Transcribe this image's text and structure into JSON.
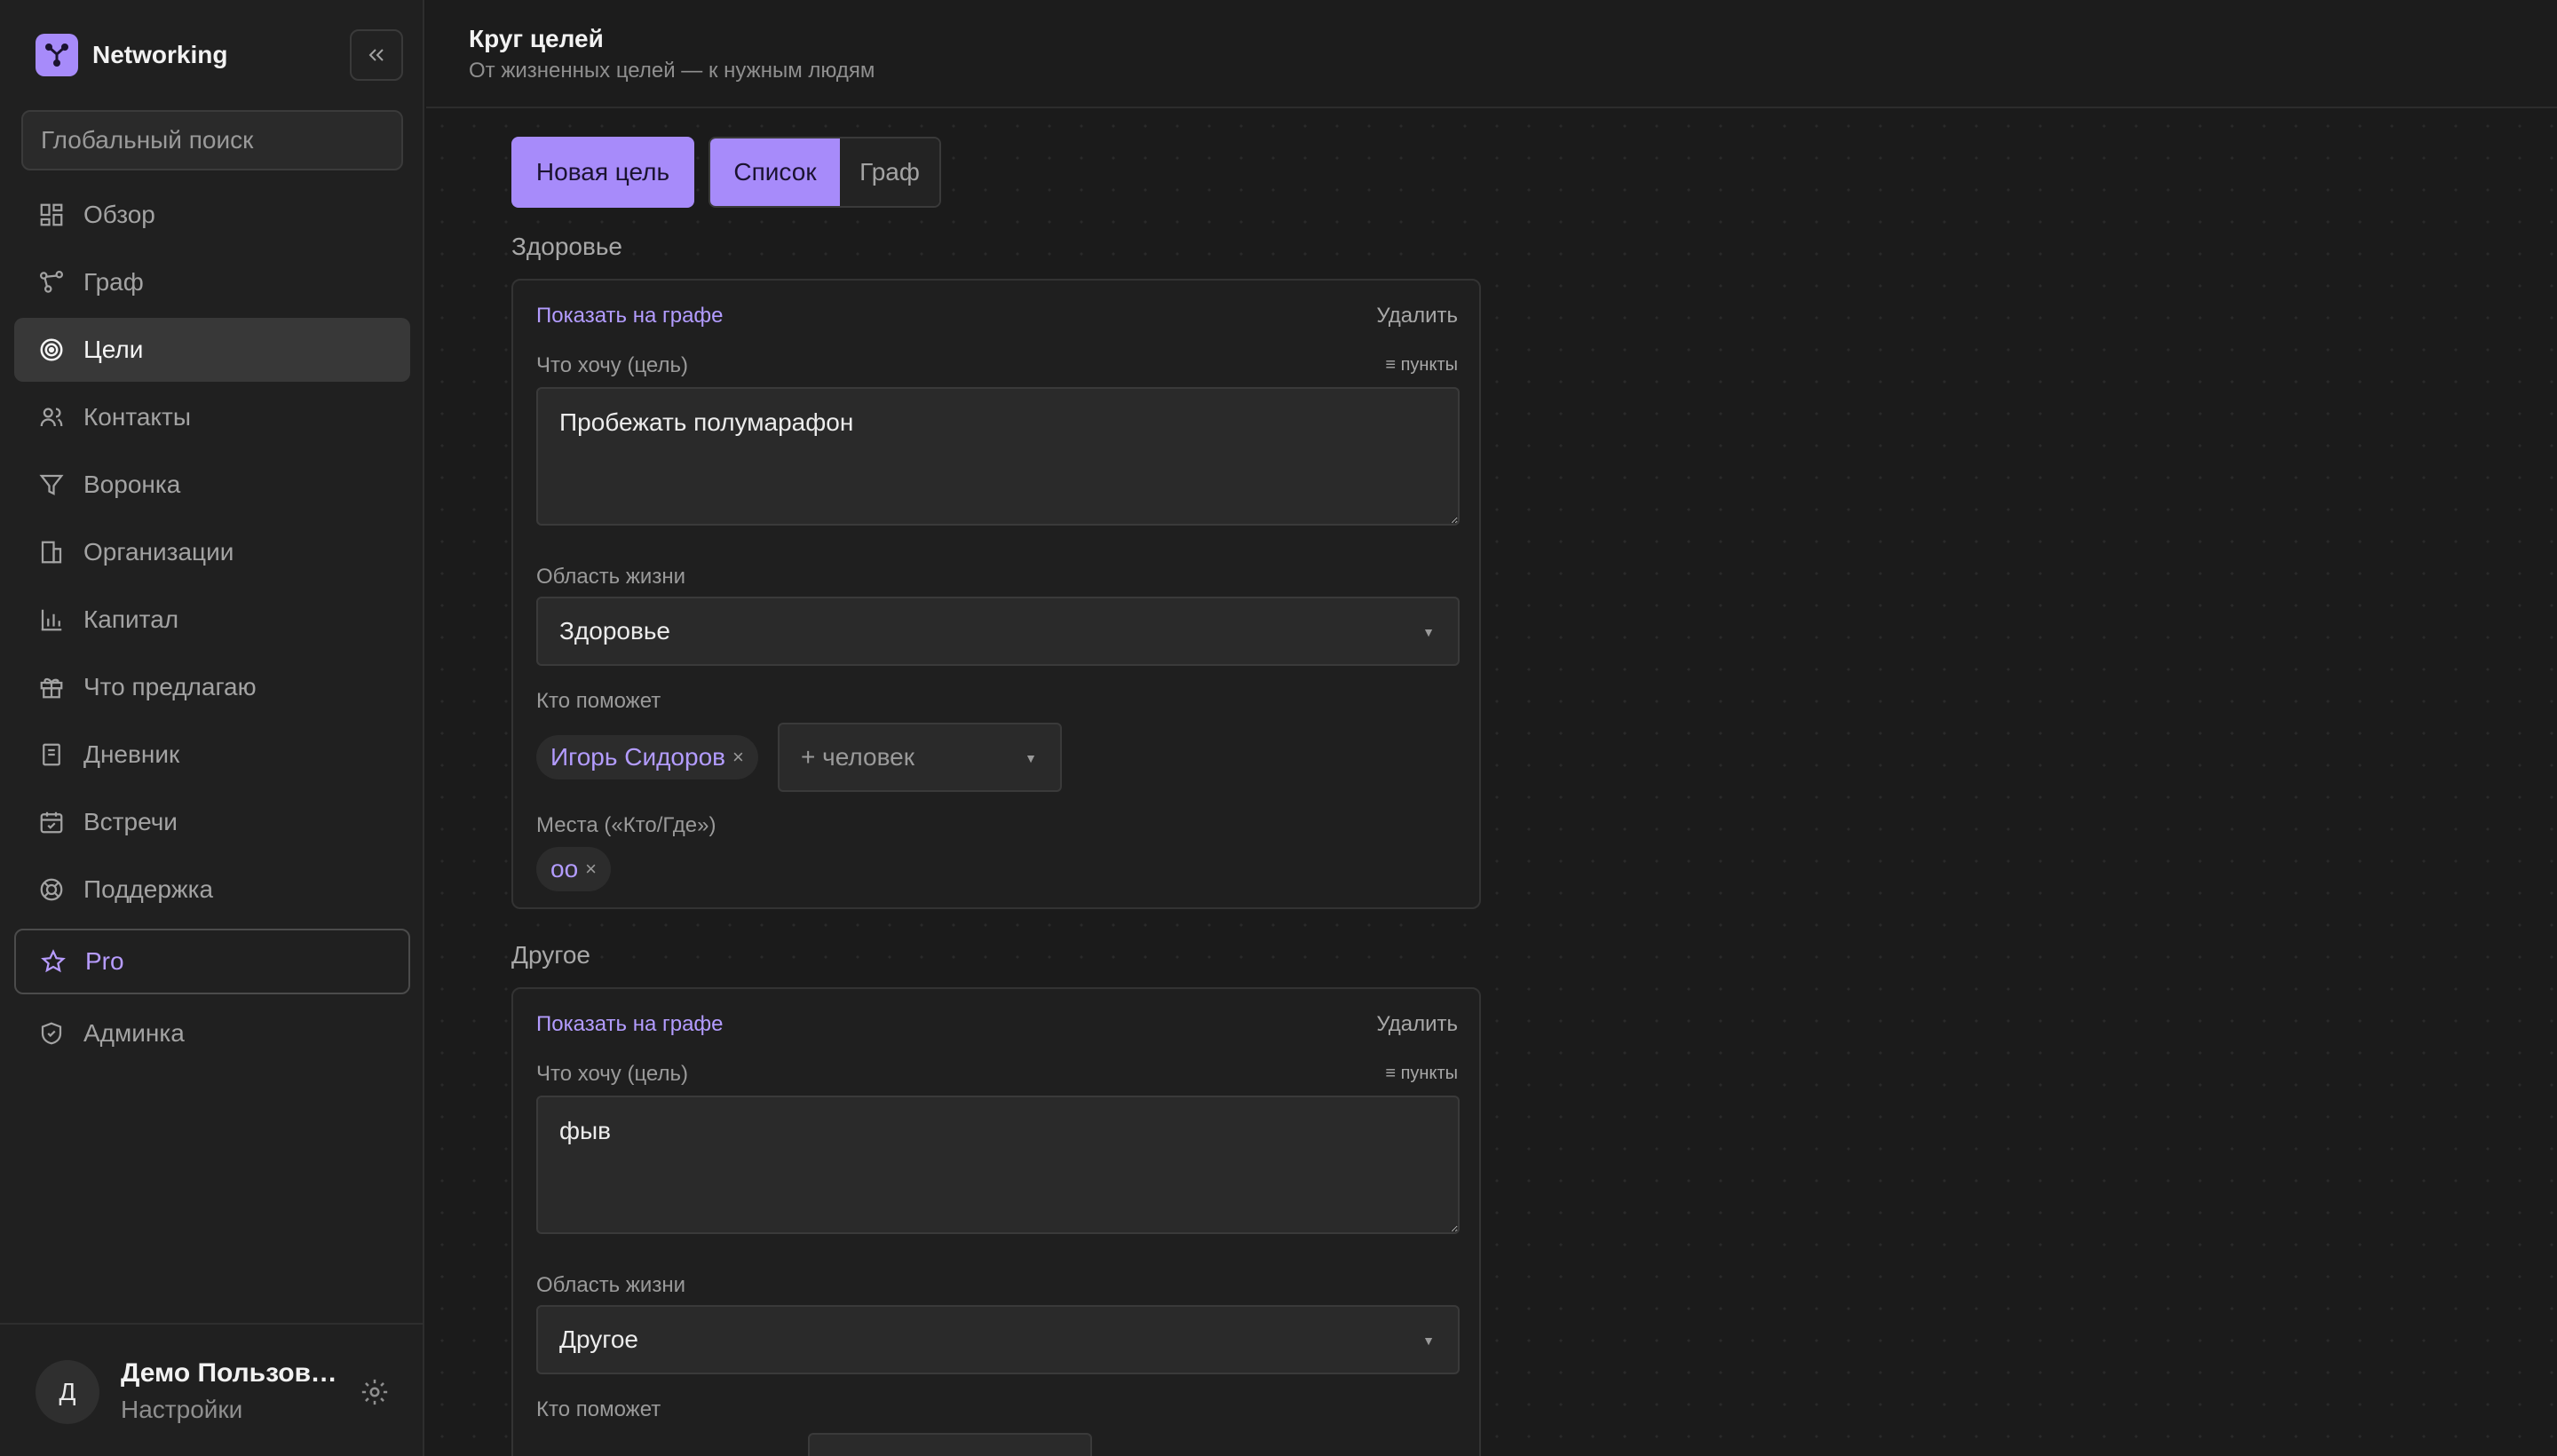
{
  "brand": {
    "name": "Networking"
  },
  "search": {
    "placeholder": "Глобальный поиск"
  },
  "nav": {
    "items": [
      {
        "label": "Обзор",
        "icon": "grid-icon"
      },
      {
        "label": "Граф",
        "icon": "graph-icon"
      },
      {
        "label": "Цели",
        "icon": "target-icon",
        "active": true
      },
      {
        "label": "Контакты",
        "icon": "users-icon"
      },
      {
        "label": "Воронка",
        "icon": "funnel-icon"
      },
      {
        "label": "Организации",
        "icon": "building-icon"
      },
      {
        "label": "Капитал",
        "icon": "bar-chart-icon"
      },
      {
        "label": "Что предлагаю",
        "icon": "gift-icon"
      },
      {
        "label": "Дневник",
        "icon": "notebook-icon"
      },
      {
        "label": "Встречи",
        "icon": "calendar-icon"
      },
      {
        "label": "Поддержка",
        "icon": "lifebuoy-icon"
      },
      {
        "label": "Pro",
        "icon": "star-icon"
      },
      {
        "label": "Админка",
        "icon": "shield-icon"
      }
    ]
  },
  "user": {
    "avatar_letter": "Д",
    "name": "Демо Пользователь",
    "settings_label": "Настройки"
  },
  "header": {
    "title": "Круг целей",
    "subtitle": "От жизненных целей — к нужным людям"
  },
  "toolbar": {
    "new_goal": "Новая цель",
    "view_list": "Список",
    "view_graph": "Граф"
  },
  "sections": [
    {
      "title": "Здоровье",
      "card": {
        "show_on_graph": "Показать на графе",
        "delete": "Удалить",
        "goal_label": "Что хочу (цель)",
        "points_toggle": "≡ пункты",
        "goal_value": "Пробежать полумарафон",
        "area_label": "Область жизни",
        "area_value": "Здоровье",
        "helpers_label": "Кто поможет",
        "helpers": [
          "Игорь Сидоров"
        ],
        "add_person": "+ человек",
        "places_label": "Места («Кто/Где»)",
        "places": [
          "оо"
        ]
      }
    },
    {
      "title": "Другое",
      "card": {
        "show_on_graph": "Показать на графе",
        "delete": "Удалить",
        "goal_label": "Что хочу (цель)",
        "points_toggle": "≡ пункты",
        "goal_value": "фыв",
        "area_label": "Область жизни",
        "area_value": "Другое",
        "helpers_label": "Кто поможет"
      }
    }
  ],
  "colors": {
    "accent": "#a78bfa",
    "background": "#1b1b1b",
    "sidebar": "#202020"
  }
}
